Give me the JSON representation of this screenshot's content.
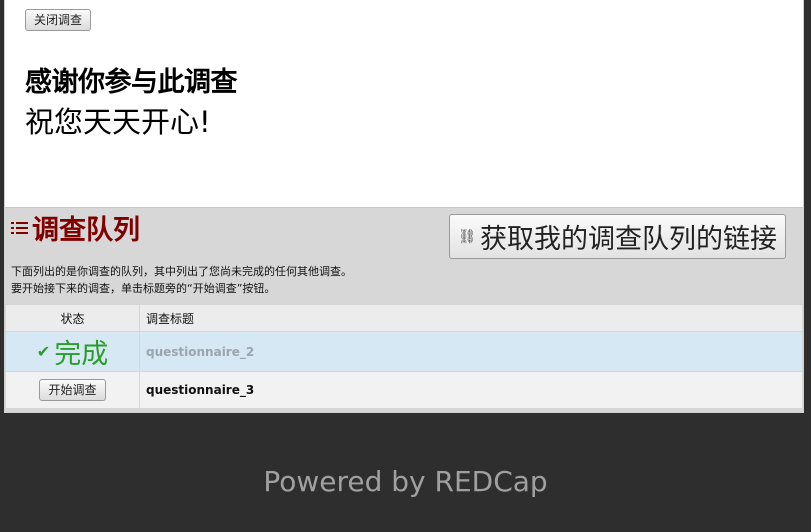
{
  "survey": {
    "close_label": "关闭调查",
    "thanks_title": "感谢你参与此调查",
    "thanks_sub": "祝您天天开心!"
  },
  "queue": {
    "title": "调查队列",
    "link_button": "获取我的调查队列的链接",
    "desc_line1": "下面列出的是你调查的队列，其中列出了您尚未完成的任何其他调查。",
    "desc_line2": "要开始接下来的调查，单击标题旁的“开始调查”按钮。",
    "headers": {
      "status": "状态",
      "title": "调查标题"
    },
    "rows": [
      {
        "status": "完成",
        "title": "questionnaire_2"
      },
      {
        "status": "开始调查",
        "title": "questionnaire_3"
      }
    ]
  },
  "footer": {
    "powered": "Powered by REDCap"
  },
  "colors": {
    "queue_title": "#800000",
    "done": "#2a9d2a",
    "done_row_bg": "#d6e8f3"
  },
  "icons": [
    "list-icon",
    "link-icon",
    "check-icon"
  ]
}
